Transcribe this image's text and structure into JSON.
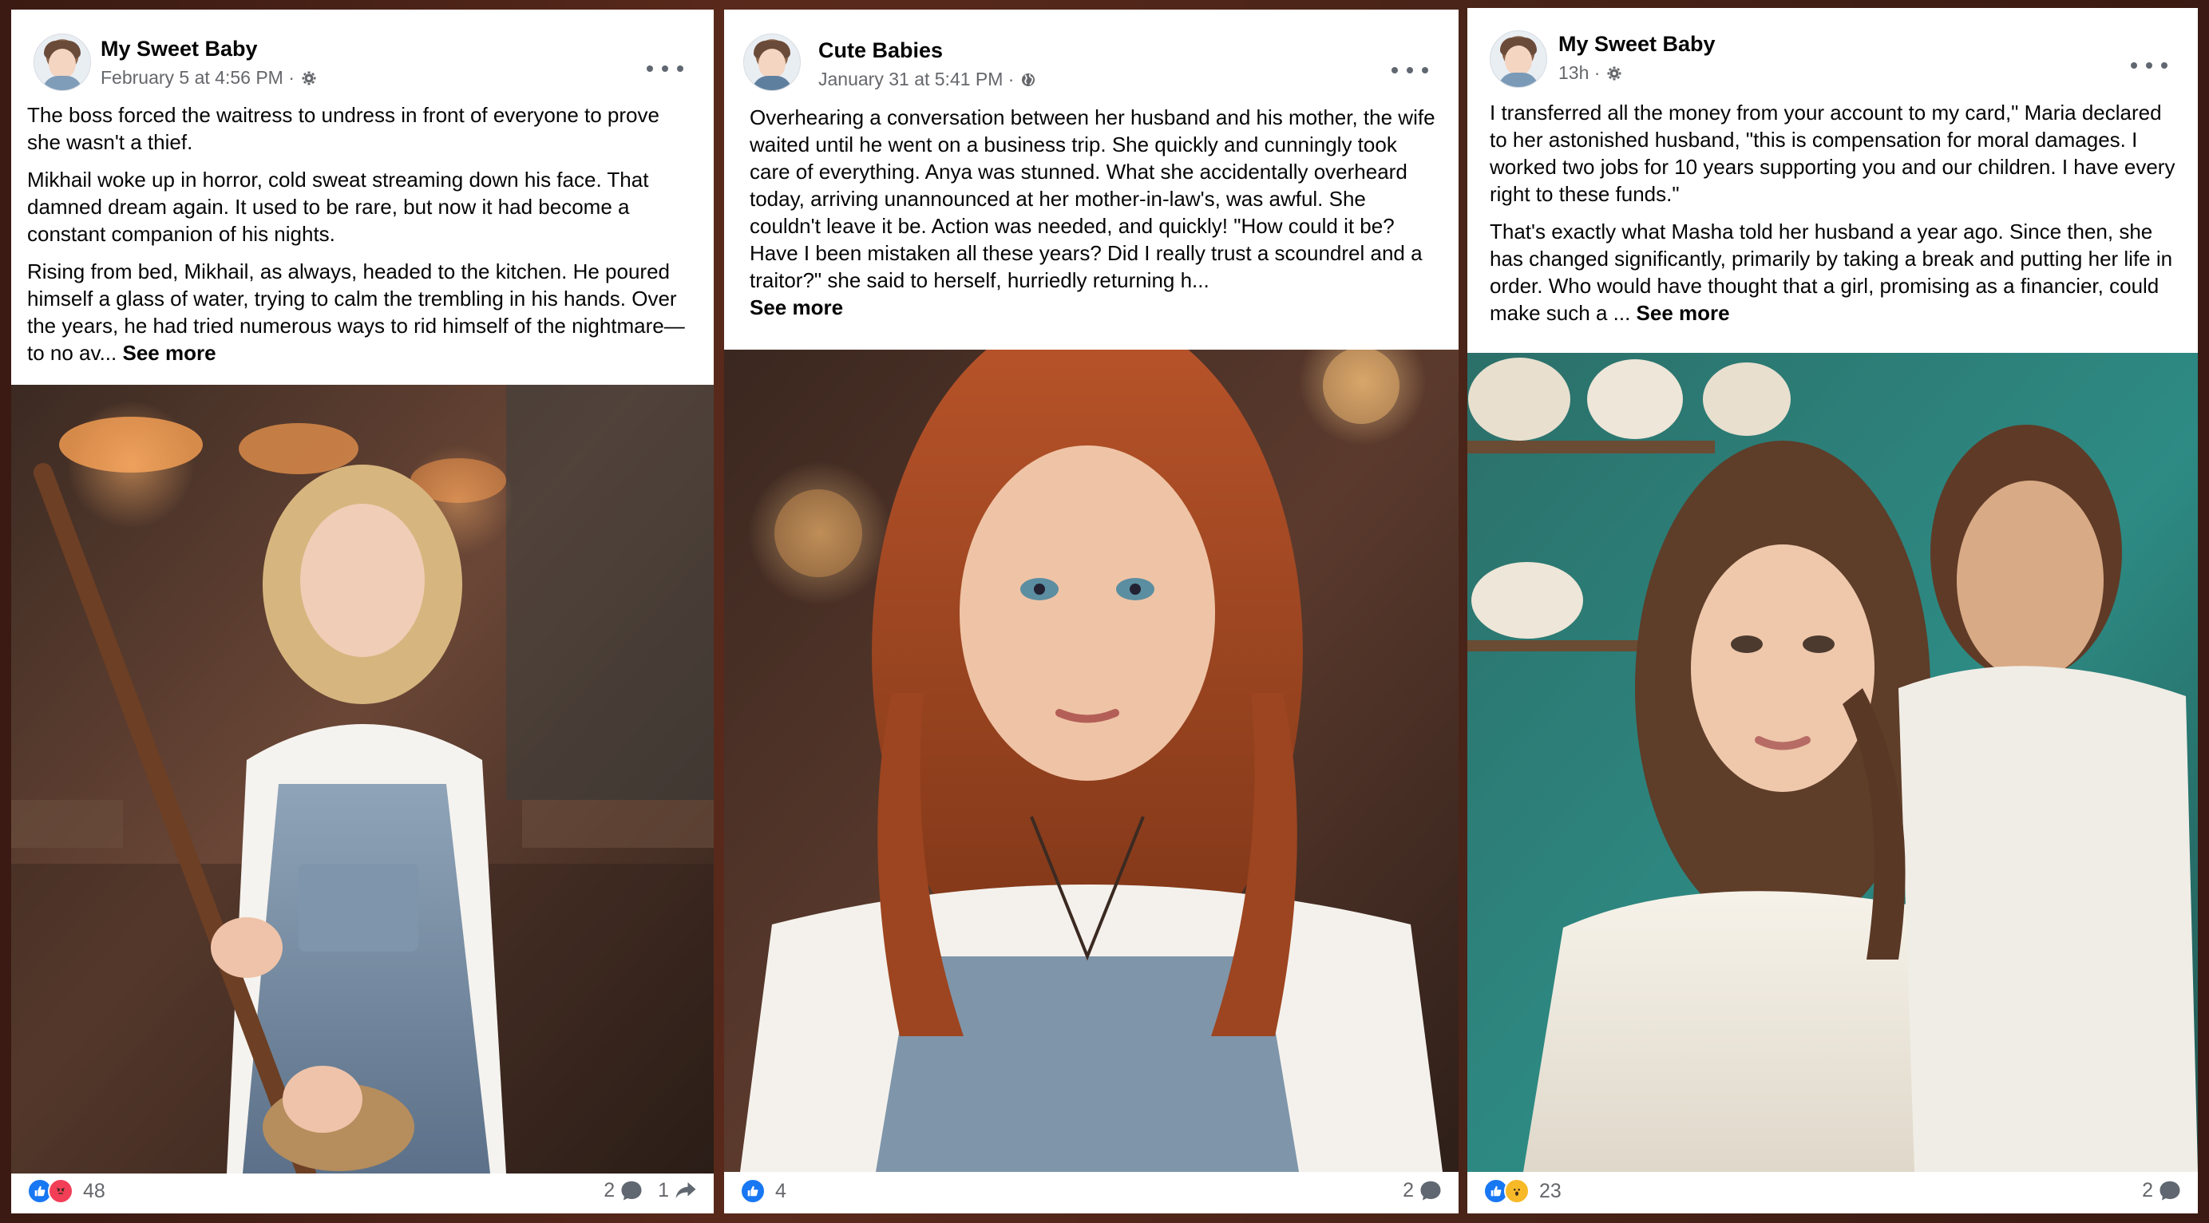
{
  "posts": [
    {
      "author": "My Sweet Baby",
      "timestamp": "February 5 at 4:56 PM ·",
      "privacy_icon": "gear-icon",
      "paragraphs": [
        "The boss forced the waitress to undress in front of everyone to prove she wasn't a thief.",
        "Mikhail woke up in horror, cold sweat streaming down his face. That damned dream again. It used to be rare, but now it had become a constant companion of his nights.",
        "Rising from bed, Mikhail, as always, headed to the kitchen. He poured himself a glass of water, trying to calm the trembling in his hands. Over the years, he had tried numerous ways to rid himself of the nightmare—to no av... "
      ],
      "see_more": "See more",
      "reactions": [
        "like",
        "angry"
      ],
      "reaction_count": "48",
      "comments": "2",
      "shares": "1"
    },
    {
      "author": "Cute Babies",
      "timestamp": "January 31 at 5:41 PM ·",
      "privacy_icon": "globe-icon",
      "paragraphs": [
        "Overhearing a conversation between her husband and his mother, the wife waited until he went on a business trip. She quickly and cunningly took care of everything. Anya was stunned. What she accidentally overheard today, arriving unannounced at her mother-in-law's, was awful. She couldn't leave it be. Action was needed, and quickly! \"How could it be? Have I been mistaken all these years? Did I really trust a scoundrel and a traitor?\" she said to herself, hurriedly returning h..."
      ],
      "see_more": "See more",
      "reactions": [
        "like"
      ],
      "reaction_count": "4",
      "comments": "2"
    },
    {
      "author": "My Sweet Baby",
      "timestamp": "13h ·",
      "privacy_icon": "gear-icon",
      "paragraphs": [
        "I transferred all the money from your account to my card,\" Maria declared to her astonished husband, \"this is compensation for moral damages. I worked two jobs for 10 years supporting you and our children. I have every right to these funds.\"",
        "That's exactly what Masha told her husband a year ago. Since then, she has changed significantly, primarily by taking a break and putting her life in order. Who would have thought that a girl, promising as a financier, could make such a ... "
      ],
      "see_more": "See more",
      "reactions": [
        "like",
        "wow"
      ],
      "reaction_count": "23",
      "comments": "2"
    }
  ],
  "colors": {
    "text_primary": "#050505",
    "text_secondary": "#65676b",
    "like_blue": "#1877f2",
    "angry_red": "#f33e58",
    "wow_yellow": "#f7b928"
  }
}
